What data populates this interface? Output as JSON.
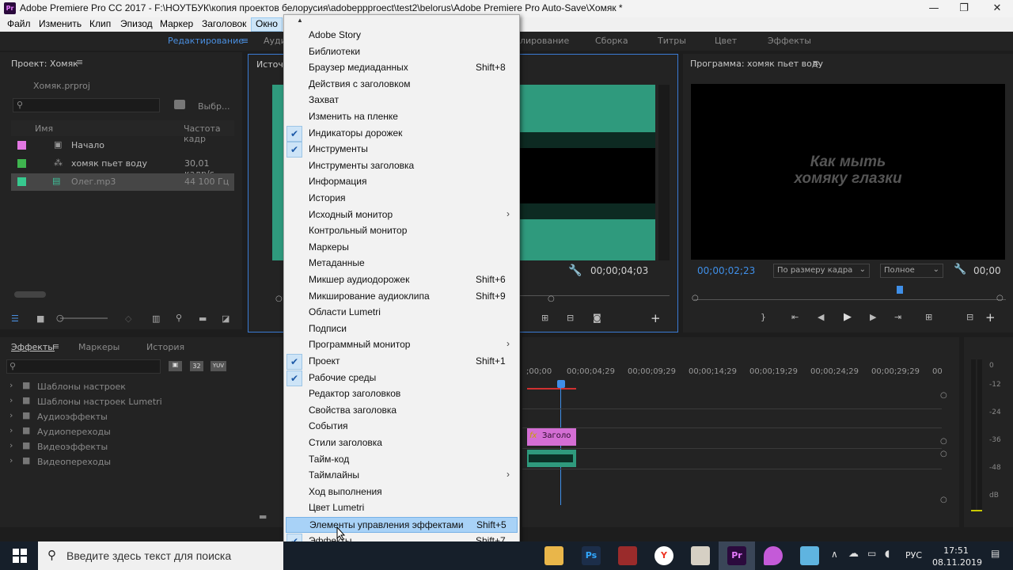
{
  "window": {
    "title": "Adobe Premiere Pro CC 2017 - F:\\НОУТБУК\\копия проектов белорусия\\adobeppproect\\test2\\belorus\\Adobe Premiere Pro Auto-Save\\Хомяк *",
    "app_icon": "Pr",
    "minimize": "—",
    "restore": "❐",
    "close": "✕"
  },
  "menubar": [
    "Файл",
    "Изменить",
    "Клип",
    "Эпизод",
    "Маркер",
    "Заголовок",
    "Окно"
  ],
  "workspaces": [
    "Редактирование",
    "Ауди",
    "лирование",
    "Сборка",
    "Титры",
    "Цвет",
    "Эффекты"
  ],
  "project": {
    "title": "Проект: Хомяк",
    "file": "Хомяк.prproj",
    "search_placeholder": "",
    "find_label": "Выбр...",
    "col_name": "Имя",
    "col_rate": "Частота кадр",
    "items": [
      {
        "name": "Начало",
        "rate": "",
        "color": "#e377e3"
      },
      {
        "name": "хомяк пьет воду",
        "rate": "30,01 кадр/с",
        "color": "#3fb54f"
      },
      {
        "name": "Олег.mp3",
        "rate": "44 100 Гц",
        "color": "#37c98f"
      }
    ]
  },
  "source": {
    "title": "Источ",
    "timecode": "00;00;04;03"
  },
  "program": {
    "title": "Программа: хомяк пьет воду",
    "overlay_line1": "Как мыть",
    "overlay_line2": "хомяку глазки",
    "timecode": "00;00;02;23",
    "fit": "По размеру кадра",
    "quality": "Полное",
    "timecode_right": "00;00"
  },
  "effects": {
    "tabs": [
      "Эффекты",
      "Маркеры",
      "История"
    ],
    "tree": [
      "Шаблоны настроек",
      "Шаблоны настроек Lumetri",
      "Аудиоэффекты",
      "Аудиопереходы",
      "Видеоэффекты",
      "Видеопереходы"
    ],
    "badges": [
      "32",
      "YUV"
    ]
  },
  "timeline": {
    "ruler": [
      ";00;00",
      "00;00;04;29",
      "00;00;09;29",
      "00;00;14;29",
      "00;00;19;29",
      "00;00;24;29",
      "00;00;29;29",
      "00"
    ],
    "clip_title": "Заголо",
    "clip_fx": "fx"
  },
  "meter": {
    "scale": [
      "0",
      "-12",
      "-24",
      "-36",
      "-48",
      "dB"
    ]
  },
  "window_menu": {
    "up_arrow": "▲",
    "down_arrow": "▼",
    "items": [
      {
        "label": "Adobe Story",
        "shortcut": "",
        "checked": false,
        "submenu": false
      },
      {
        "label": "Библиотеки",
        "shortcut": "",
        "checked": false,
        "submenu": false
      },
      {
        "label": "Браузер медиаданных",
        "shortcut": "Shift+8",
        "checked": false,
        "submenu": false
      },
      {
        "label": "Действия с заголовком",
        "shortcut": "",
        "checked": false,
        "submenu": false
      },
      {
        "label": "Захват",
        "shortcut": "",
        "checked": false,
        "submenu": false
      },
      {
        "label": "Изменить на пленке",
        "shortcut": "",
        "checked": false,
        "submenu": false
      },
      {
        "label": "Индикаторы дорожек",
        "shortcut": "",
        "checked": true,
        "submenu": false
      },
      {
        "label": "Инструменты",
        "shortcut": "",
        "checked": true,
        "submenu": false
      },
      {
        "label": "Инструменты заголовка",
        "shortcut": "",
        "checked": false,
        "submenu": false
      },
      {
        "label": "Информация",
        "shortcut": "",
        "checked": false,
        "submenu": false
      },
      {
        "label": "История",
        "shortcut": "",
        "checked": false,
        "submenu": false
      },
      {
        "label": "Исходный монитор",
        "shortcut": "",
        "checked": false,
        "submenu": true
      },
      {
        "label": "Контрольный монитор",
        "shortcut": "",
        "checked": false,
        "submenu": false
      },
      {
        "label": "Маркеры",
        "shortcut": "",
        "checked": false,
        "submenu": false
      },
      {
        "label": "Метаданные",
        "shortcut": "",
        "checked": false,
        "submenu": false
      },
      {
        "label": "Микшер аудиодорожек",
        "shortcut": "Shift+6",
        "checked": false,
        "submenu": false
      },
      {
        "label": "Микширование аудиоклипа",
        "shortcut": "Shift+9",
        "checked": false,
        "submenu": false
      },
      {
        "label": "Области Lumetri",
        "shortcut": "",
        "checked": false,
        "submenu": false
      },
      {
        "label": "Подписи",
        "shortcut": "",
        "checked": false,
        "submenu": false
      },
      {
        "label": "Программный монитор",
        "shortcut": "",
        "checked": false,
        "submenu": true
      },
      {
        "label": "Проект",
        "shortcut": "Shift+1",
        "checked": true,
        "submenu": false
      },
      {
        "label": "Рабочие среды",
        "shortcut": "",
        "checked": true,
        "submenu": false
      },
      {
        "label": "Редактор заголовков",
        "shortcut": "",
        "checked": false,
        "submenu": false
      },
      {
        "label": "Свойства заголовка",
        "shortcut": "",
        "checked": false,
        "submenu": false
      },
      {
        "label": "События",
        "shortcut": "",
        "checked": false,
        "submenu": false
      },
      {
        "label": "Стили заголовка",
        "shortcut": "",
        "checked": false,
        "submenu": false
      },
      {
        "label": "Тайм-код",
        "shortcut": "",
        "checked": false,
        "submenu": false
      },
      {
        "label": "Таймлайны",
        "shortcut": "",
        "checked": false,
        "submenu": true
      },
      {
        "label": "Ход выполнения",
        "shortcut": "",
        "checked": false,
        "submenu": false
      },
      {
        "label": "Цвет Lumetri",
        "shortcut": "",
        "checked": false,
        "submenu": false
      },
      {
        "label": "Элементы управления эффектами",
        "shortcut": "Shift+5",
        "checked": false,
        "submenu": false,
        "highlighted": true
      },
      {
        "label": "Эффекты",
        "shortcut": "Shift+7",
        "checked": true,
        "submenu": false
      }
    ]
  },
  "taskbar": {
    "search_placeholder": "Введите здесь текст для поиска",
    "lang": "РУС",
    "time": "17:51",
    "date": "08.11.2019"
  }
}
